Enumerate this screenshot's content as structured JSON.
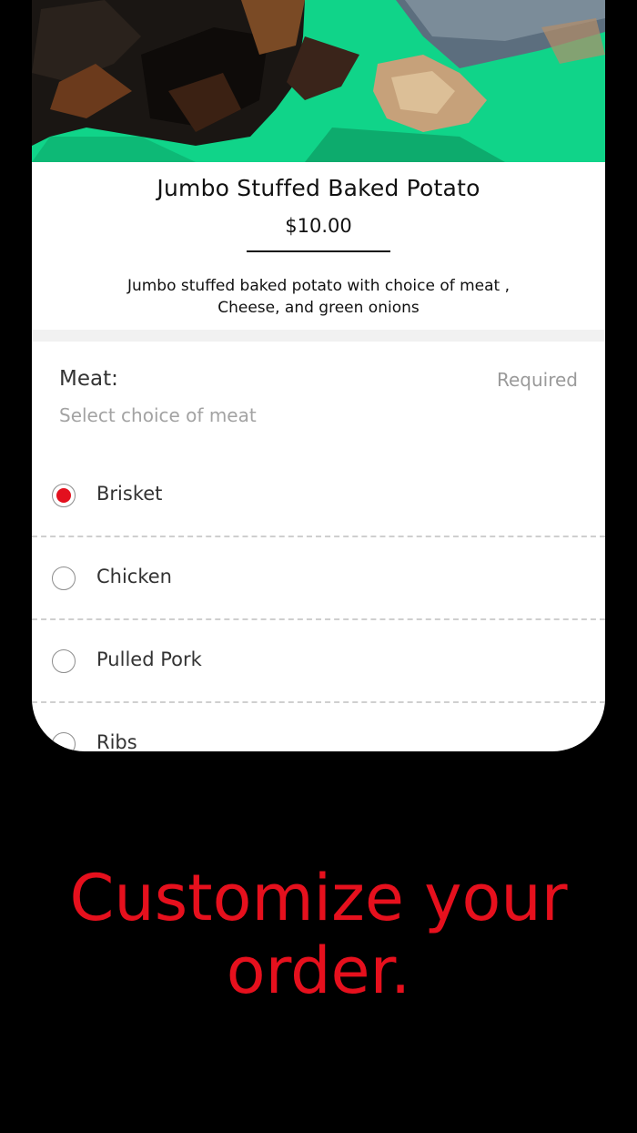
{
  "product": {
    "image_alt": "smoked brisket on green cutting board",
    "title": "Jumbo Stuffed Baked Potato",
    "price": "$10.00",
    "description_line1": "Jumbo stuffed baked potato with choice of meat ,",
    "description_line2": "Cheese, and green onions"
  },
  "modifier_group": {
    "title": "Meat:",
    "required_label": "Required",
    "subtitle": "Select choice of meat",
    "options": [
      {
        "label": "Brisket",
        "selected": true
      },
      {
        "label": "Chicken",
        "selected": false
      },
      {
        "label": "Pulled Pork",
        "selected": false
      },
      {
        "label": "Ribs",
        "selected": false
      }
    ]
  },
  "tagline": {
    "line1": "Customize your",
    "line2": "order."
  },
  "colors": {
    "accent": "#e3101e",
    "background": "#000000",
    "cutting_board": "#0fd487"
  }
}
